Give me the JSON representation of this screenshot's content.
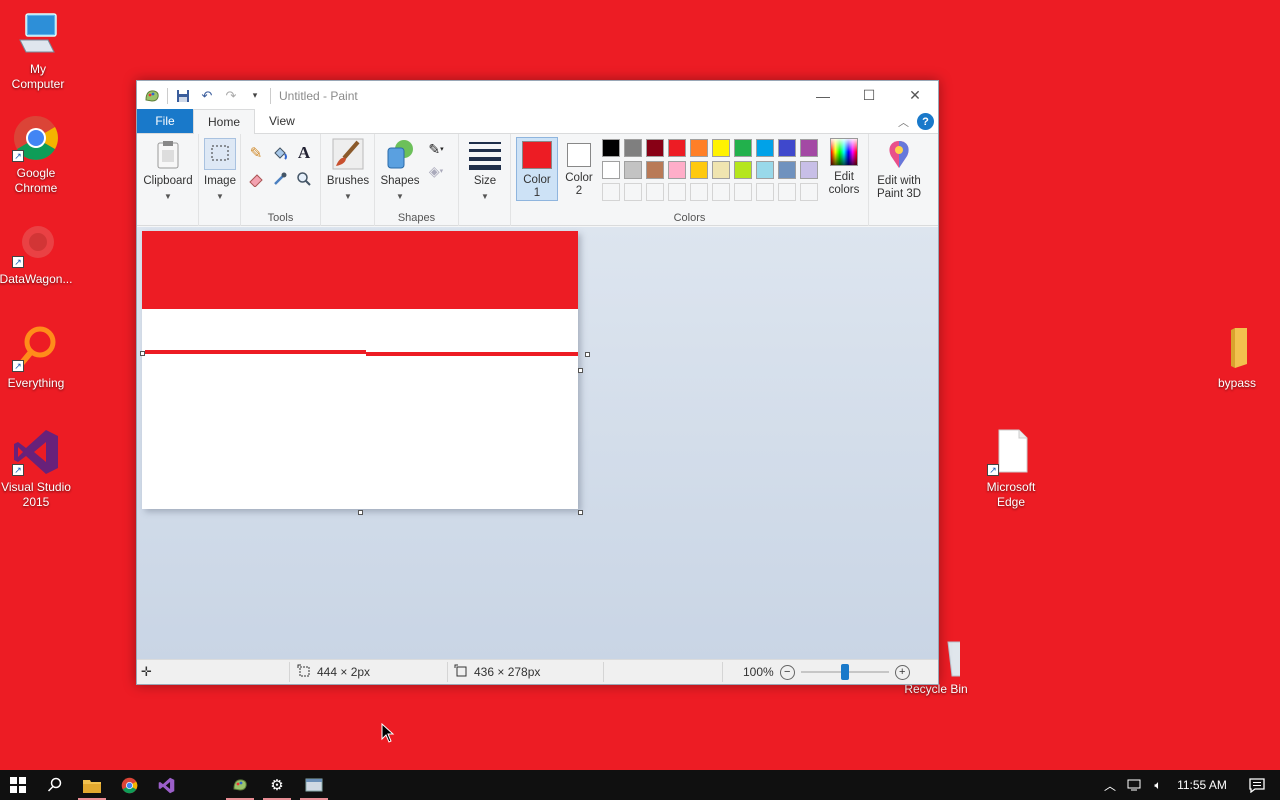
{
  "desktop": {
    "background": "#ed1c24",
    "icons": [
      {
        "label": "My\nComputer",
        "icon": "computer-icon"
      },
      {
        "label": "Google\nChrome",
        "icon": "chrome-icon"
      },
      {
        "label": "DataWagon...",
        "icon": "datawagon-icon"
      },
      {
        "label": "Everything",
        "icon": "everything-search-icon"
      },
      {
        "label": "Visual Studio\n2015",
        "icon": "visual-studio-icon"
      },
      {
        "label": "bypass",
        "icon": "folder-icon"
      },
      {
        "label": "Microsoft\nEdge",
        "icon": "file-icon"
      },
      {
        "label": "Recycle Bin",
        "icon": "recycle-bin-icon"
      }
    ]
  },
  "paint": {
    "title": "Untitled - Paint",
    "tabs": {
      "file": "File",
      "home": "Home",
      "view": "View"
    },
    "help": "?",
    "groups": {
      "clipboard": "Clipboard",
      "image": "Image",
      "tools": "Tools",
      "brushes": "Brushes",
      "shapes_btn": "Shapes",
      "shapes": "Shapes",
      "size": "Size",
      "color1": "Color\n1",
      "color2": "Color\n2",
      "colors": "Colors",
      "edit_colors": "Edit\ncolors",
      "paint3d": "Edit with\nPaint 3D"
    },
    "color1": "#ed1c24",
    "color2": "#ffffff",
    "palette_row1": [
      "#000000",
      "#7f7f7f",
      "#880015",
      "#ed1c24",
      "#ff7f27",
      "#fff200",
      "#22b14c",
      "#00a2e8",
      "#3f48cc",
      "#a349a4"
    ],
    "palette_row2": [
      "#ffffff",
      "#c3c3c3",
      "#b97a57",
      "#ffaec9",
      "#ffc90e",
      "#efe4b0",
      "#b5e61d",
      "#99d9ea",
      "#7092be",
      "#c8bfe7"
    ],
    "status": {
      "selection_size": "444 × 2px",
      "canvas_size": "436 × 278px",
      "zoom": "100%"
    }
  },
  "taskbar": {
    "time": "11:55 AM"
  }
}
